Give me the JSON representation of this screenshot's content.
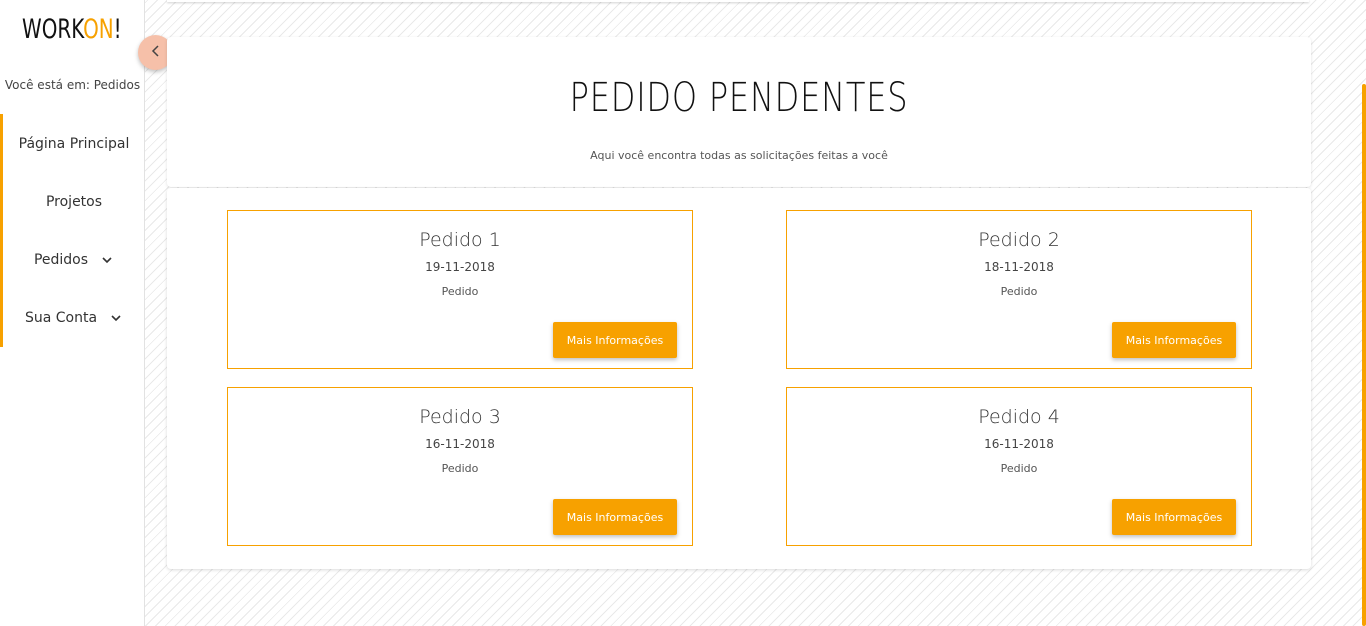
{
  "app": {
    "logo_part1": "WORK",
    "logo_part2": "ON",
    "logo_part3": "!"
  },
  "sidebar": {
    "breadcrumb": "Você está em: Pedidos",
    "items": [
      {
        "label": "Página Principal",
        "has_chevron": false
      },
      {
        "label": "Projetos",
        "has_chevron": false
      },
      {
        "label": "Pedidos",
        "has_chevron": true
      },
      {
        "label": "Sua Conta",
        "has_chevron": true
      }
    ]
  },
  "header": {
    "title": "PEDIDO PENDENTES",
    "subtitle": "Aqui você encontra todas as solicitações feitas a você"
  },
  "orders": [
    {
      "title": "Pedido 1",
      "date": "19-11-2018",
      "type": "Pedido",
      "button_label": "Mais Informações"
    },
    {
      "title": "Pedido 2",
      "date": "18-11-2018",
      "type": "Pedido",
      "button_label": "Mais Informações"
    },
    {
      "title": "Pedido 3",
      "date": "16-11-2018",
      "type": "Pedido",
      "button_label": "Mais Informações"
    },
    {
      "title": "Pedido 4",
      "date": "16-11-2018",
      "type": "Pedido",
      "button_label": "Mais Informações"
    }
  ],
  "colors": {
    "accent": "#f7a100",
    "collapse_button": "#f6c0a9"
  },
  "icons": {
    "collapse": "chevron-left-icon",
    "expand": "chevron-down-icon"
  }
}
